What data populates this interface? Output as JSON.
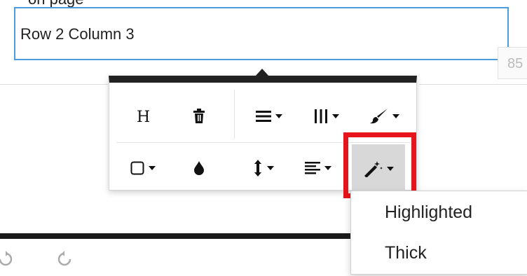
{
  "page": {
    "top_label": "on page",
    "cell_input_value": "Row 2 Column 3",
    "side_number": "85"
  },
  "toolbar": {
    "row1": [
      {
        "name": "heading-button",
        "icon": "heading-icon",
        "glyph": "H",
        "dropdown": false
      },
      {
        "name": "delete-button",
        "icon": "trash-icon",
        "glyph": "🗑",
        "dropdown": false
      },
      {
        "name": "rows-button",
        "icon": "rows-icon",
        "glyph": "≡",
        "dropdown": true
      },
      {
        "name": "columns-button",
        "icon": "columns-icon",
        "glyph": "|||",
        "dropdown": true
      },
      {
        "name": "brush-button",
        "icon": "paint-brush-icon",
        "glyph": "🖌",
        "dropdown": true
      }
    ],
    "row2": [
      {
        "name": "border-button",
        "icon": "square-outline-icon",
        "glyph": "☐",
        "dropdown": true
      },
      {
        "name": "fill-color-button",
        "icon": "droplet-icon",
        "glyph": "💧",
        "dropdown": false
      },
      {
        "name": "vertical-align-button",
        "icon": "vertical-arrows-icon",
        "glyph": "↕",
        "dropdown": true
      },
      {
        "name": "text-align-button",
        "icon": "align-left-icon",
        "glyph": "≣",
        "dropdown": true
      },
      {
        "name": "style-button",
        "icon": "magic-wand-icon",
        "glyph": "✎",
        "dropdown": true,
        "active": true
      }
    ]
  },
  "dropdown": {
    "items": [
      "Highlighted",
      "Thick"
    ]
  },
  "colors": {
    "focus_border": "#4a9be0",
    "highlight_frame": "#e8141b",
    "toolbar_top": "#222222",
    "active_button_bg": "#d8d8d8"
  },
  "footer": {
    "icons": [
      "undo-icon",
      "redo-icon"
    ]
  }
}
